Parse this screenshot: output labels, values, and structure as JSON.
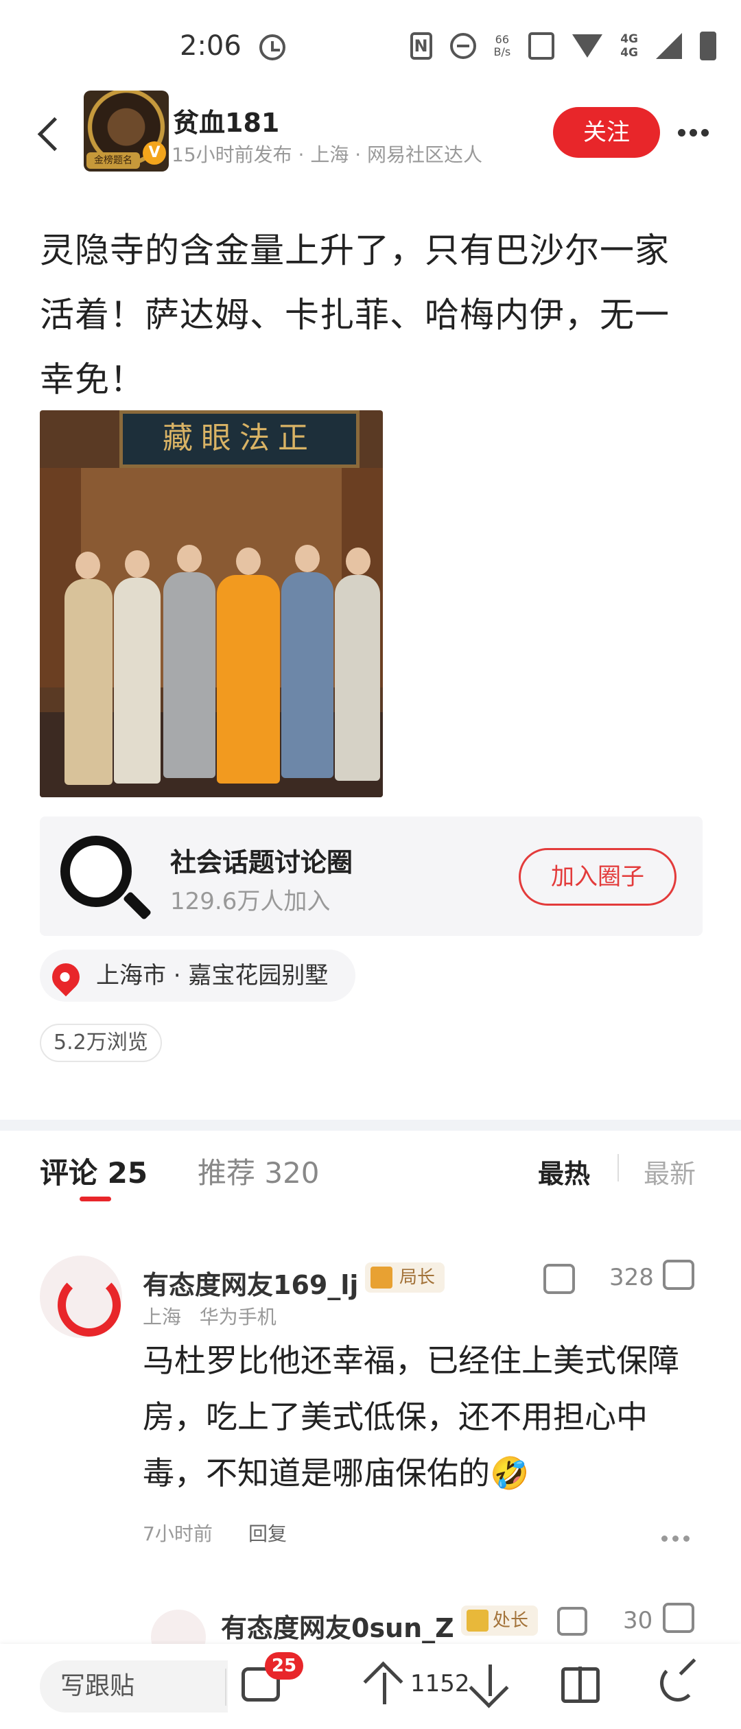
{
  "status_bar": {
    "time": "2:06",
    "net_speed": "66\nB/s",
    "network": "4G\n4G"
  },
  "author": {
    "name": "贫血181",
    "avatar_badge": "金榜题名",
    "meta": "15小时前发布 · 上海 · 网易社区达人",
    "follow_label": "关注"
  },
  "post": {
    "text": "灵隐寺的含金量上升了，只有巴沙尔一家活着！萨达姆、卡扎菲、哈梅内伊，无一幸免！",
    "photo_plaque": "藏眼法正"
  },
  "circle": {
    "name": "社会话题讨论圈",
    "members": "129.6万人加入",
    "join_label": "加入圈子"
  },
  "location": "上海市 · 嘉宝花园别墅",
  "views": "5.2万浏览",
  "tabs": {
    "comments": "评论 25",
    "recommend": "推荐 320",
    "sort_hot": "最热",
    "sort_new": "最新"
  },
  "comment": {
    "name": "有态度网友169_lj",
    "rank": "局长",
    "meta": "上海   华为手机",
    "likes": "328",
    "text": "马杜罗比他还幸福，已经住上美式保障房，吃上了美式低保，还不用担心中毒，不知道是哪庙保佑的🤣",
    "time": "7小时前",
    "reply_label": "回复"
  },
  "sub_comment": {
    "name": "有态度网友0sun_Z",
    "rank": "处长",
    "likes": "30"
  },
  "bottom_bar": {
    "reply_placeholder": "写跟贴",
    "comment_badge": "25",
    "vote_count": "1152"
  },
  "colors": {
    "accent": "#e8262a",
    "muted_text": "#999999"
  },
  "icons": [
    "back-icon",
    "clock-icon",
    "nfc-icon",
    "dnd-icon",
    "wifi-icon",
    "signal-icon",
    "battery-icon",
    "more-icon",
    "verified-icon",
    "globe-search-icon",
    "location-pin-icon",
    "thumb-down-icon",
    "thumb-up-icon",
    "comment-icon",
    "upvote-icon",
    "downvote-icon",
    "gift-icon",
    "share-icon"
  ]
}
